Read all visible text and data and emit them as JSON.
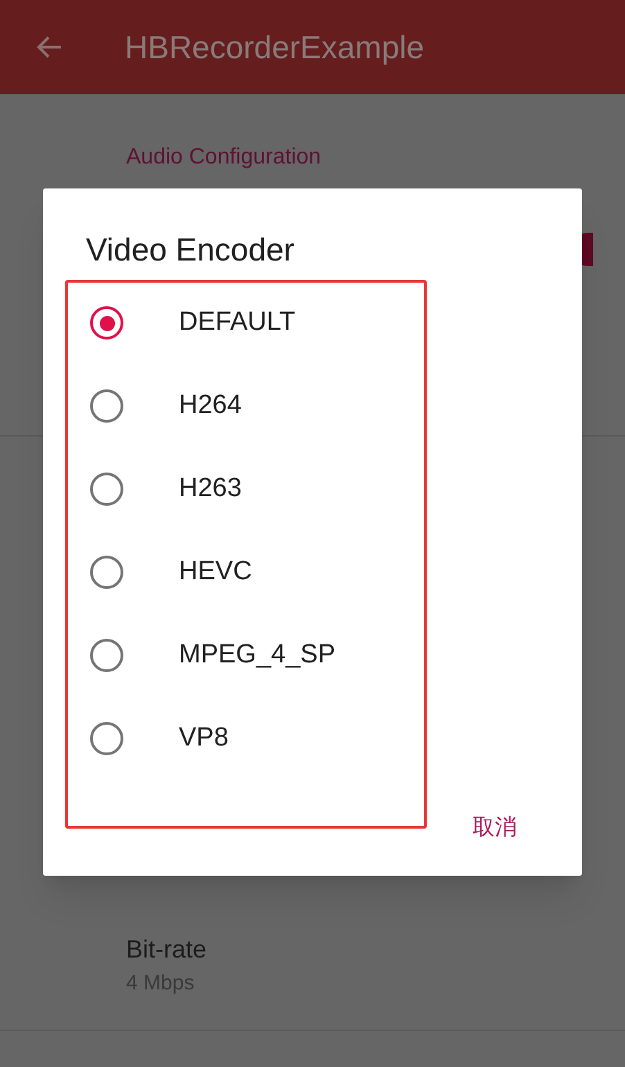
{
  "app_bar": {
    "title": "HBRecorderExample"
  },
  "settings": {
    "section_header": "Audio Configuration",
    "switch_on": true,
    "items": [
      {
        "title": "Bit-rate",
        "summary": "4 Mbps"
      }
    ]
  },
  "dialog": {
    "title": "Video Encoder",
    "options": [
      {
        "label": "DEFAULT",
        "selected": true
      },
      {
        "label": "H264",
        "selected": false
      },
      {
        "label": "H263",
        "selected": false
      },
      {
        "label": "HEVC",
        "selected": false
      },
      {
        "label": "MPEG_4_SP",
        "selected": false
      },
      {
        "label": "VP8",
        "selected": false
      }
    ],
    "cancel": "取消"
  }
}
